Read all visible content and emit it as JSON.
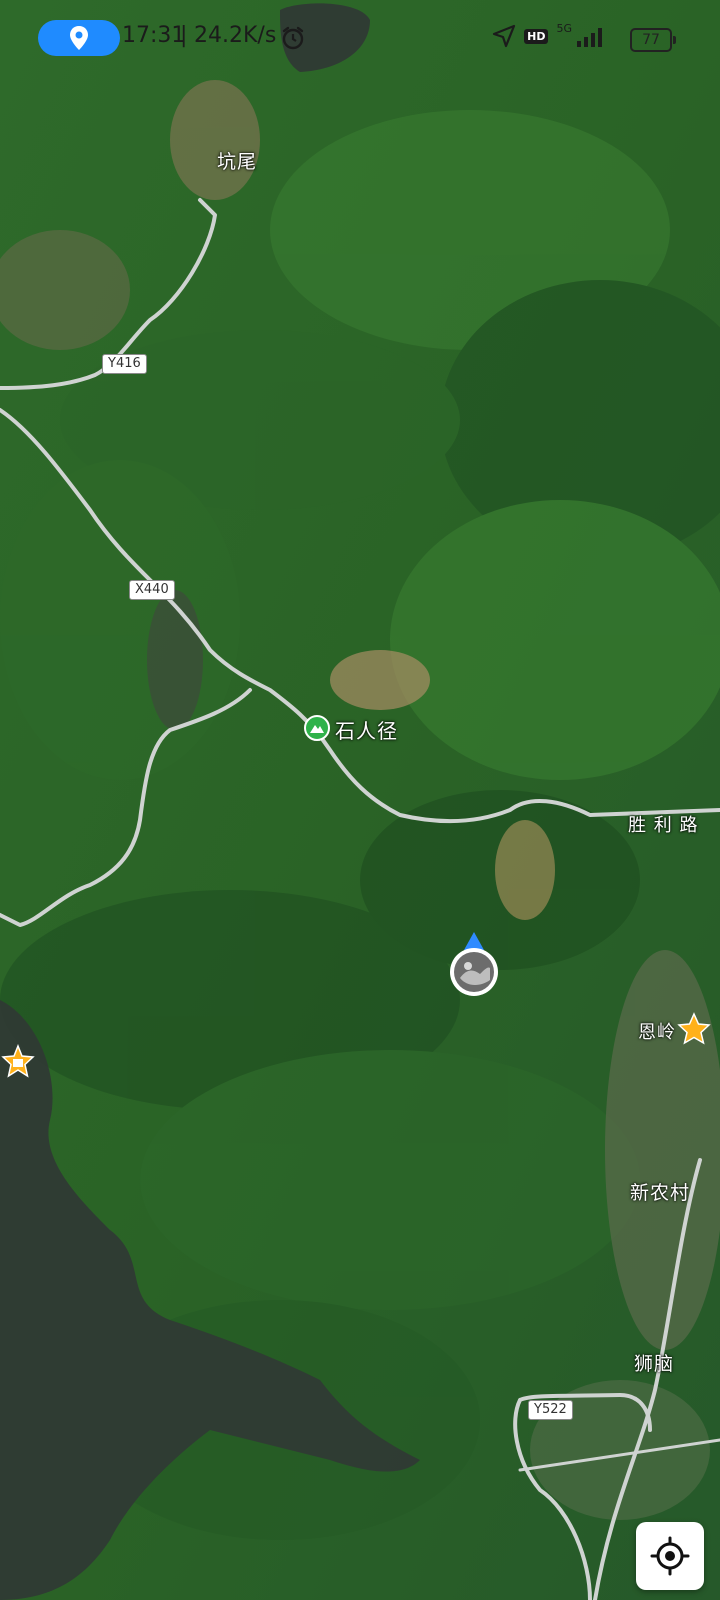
{
  "status_bar": {
    "time": "17:31",
    "net_speed": "24.2K/s",
    "network": "5G",
    "hd": "HD",
    "battery": "77"
  },
  "map": {
    "places": {
      "kengwei": "坑尾",
      "shirenjing": "石人径",
      "shengli_road": "胜 利 路",
      "enling": "恩岭",
      "xinnongcun": "新农村",
      "shinao": "狮脑"
    },
    "road_shields": {
      "y416": "Y416",
      "x440": "X440",
      "y522": "Y522"
    }
  },
  "colors": {
    "accent_blue": "#1f8bff",
    "poi_green": "#2fb24a",
    "star_orange": "#ffb11a",
    "road": "#cfd3d1"
  }
}
